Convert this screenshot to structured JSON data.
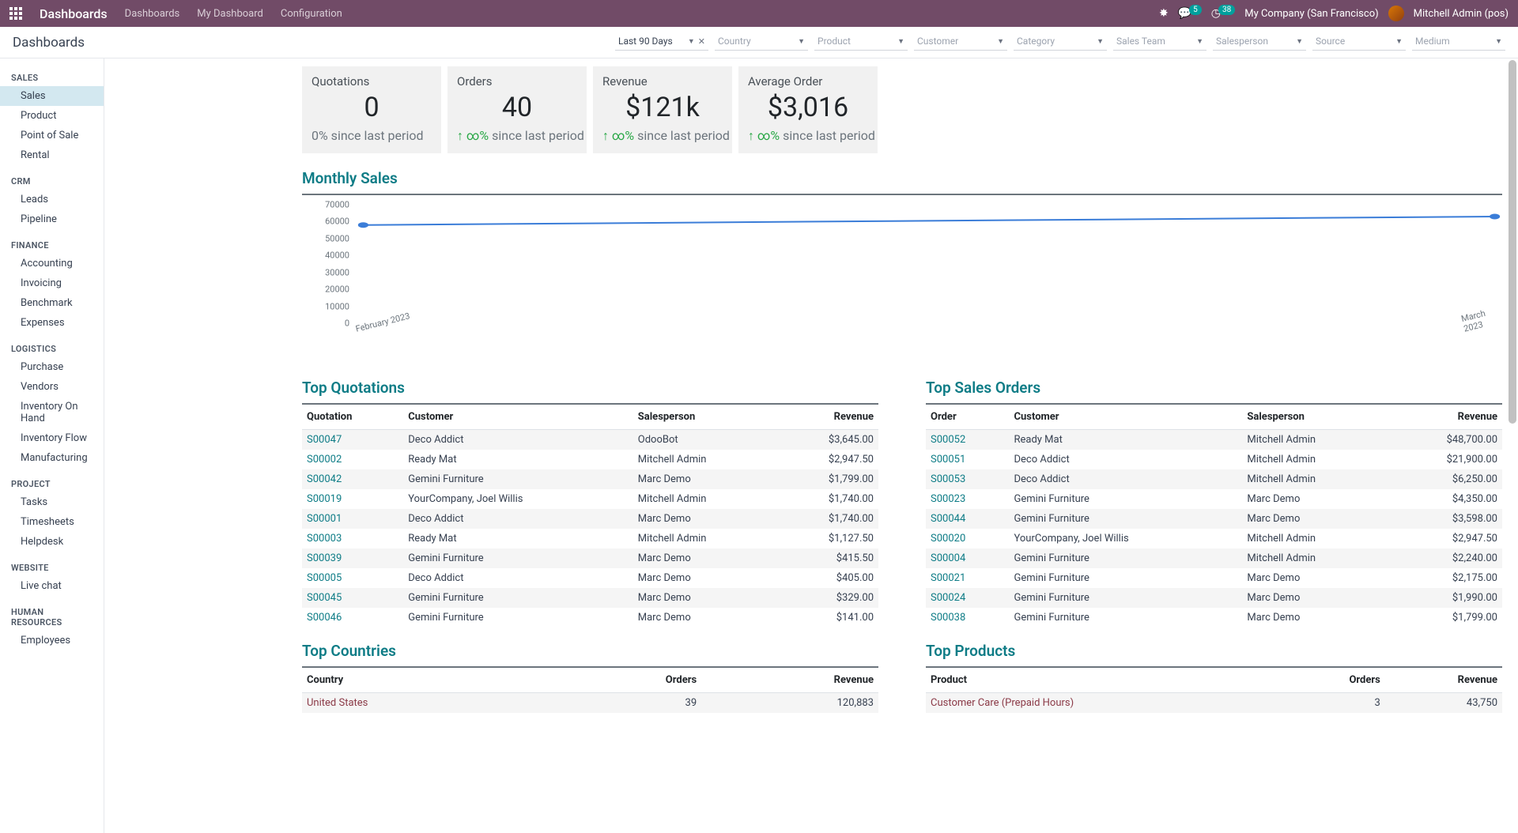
{
  "topnav": {
    "brand": "Dashboards",
    "links": [
      "Dashboards",
      "My Dashboard",
      "Configuration"
    ],
    "msg_badge": "5",
    "clock_badge": "38",
    "company": "My Company (San Francisco)",
    "user": "Mitchell Admin (pos)"
  },
  "page_title": "Dashboards",
  "filters": {
    "period": "Last 90 Days",
    "placeholders": [
      "Country",
      "Product",
      "Customer",
      "Category",
      "Sales Team",
      "Salesperson",
      "Source",
      "Medium"
    ]
  },
  "sidebar": [
    {
      "header": "SALES",
      "items": [
        "Sales",
        "Product",
        "Point of Sale",
        "Rental"
      ],
      "active": "Sales"
    },
    {
      "header": "CRM",
      "items": [
        "Leads",
        "Pipeline"
      ]
    },
    {
      "header": "FINANCE",
      "items": [
        "Accounting",
        "Invoicing",
        "Benchmark",
        "Expenses"
      ]
    },
    {
      "header": "LOGISTICS",
      "items": [
        "Purchase",
        "Vendors",
        "Inventory On Hand",
        "Inventory Flow",
        "Manufacturing"
      ]
    },
    {
      "header": "PROJECT",
      "items": [
        "Tasks",
        "Timesheets",
        "Helpdesk"
      ]
    },
    {
      "header": "WEBSITE",
      "items": [
        "Live chat"
      ]
    },
    {
      "header": "HUMAN RESOURCES",
      "items": [
        "Employees"
      ]
    }
  ],
  "kpis": [
    {
      "label": "Quotations",
      "value": "0",
      "delta": "0% since last period",
      "trend": "none"
    },
    {
      "label": "Orders",
      "value": "40",
      "delta": "∞% since last period",
      "trend": "up"
    },
    {
      "label": "Revenue",
      "value": "$121k",
      "delta": "∞% since last period",
      "trend": "up"
    },
    {
      "label": "Average Order",
      "value": "$3,016",
      "delta": "∞% since last period",
      "trend": "up"
    }
  ],
  "chart_title": "Monthly Sales",
  "chart_data": {
    "type": "line",
    "x": [
      "February 2023",
      "March 2023"
    ],
    "values": [
      58000,
      63000
    ],
    "ylim": [
      0,
      70000
    ],
    "yticks": [
      0,
      10000,
      20000,
      30000,
      40000,
      50000,
      60000,
      70000
    ],
    "xlabel": "",
    "ylabel": ""
  },
  "top_quotations": {
    "title": "Top Quotations",
    "columns": [
      "Quotation",
      "Customer",
      "Salesperson",
      "Revenue"
    ],
    "rows": [
      [
        "S00047",
        "Deco Addict",
        "OdooBot",
        "$3,645.00"
      ],
      [
        "S00002",
        "Ready Mat",
        "Mitchell Admin",
        "$2,947.50"
      ],
      [
        "S00042",
        "Gemini Furniture",
        "Marc Demo",
        "$1,799.00"
      ],
      [
        "S00019",
        "YourCompany, Joel Willis",
        "Mitchell Admin",
        "$1,740.00"
      ],
      [
        "S00001",
        "Deco Addict",
        "Marc Demo",
        "$1,740.00"
      ],
      [
        "S00003",
        "Ready Mat",
        "Mitchell Admin",
        "$1,127.50"
      ],
      [
        "S00039",
        "Gemini Furniture",
        "Marc Demo",
        "$415.50"
      ],
      [
        "S00005",
        "Deco Addict",
        "Marc Demo",
        "$405.00"
      ],
      [
        "S00045",
        "Gemini Furniture",
        "Marc Demo",
        "$329.00"
      ],
      [
        "S00046",
        "Gemini Furniture",
        "Marc Demo",
        "$141.00"
      ]
    ]
  },
  "top_orders": {
    "title": "Top Sales Orders",
    "columns": [
      "Order",
      "Customer",
      "Salesperson",
      "Revenue"
    ],
    "rows": [
      [
        "S00052",
        "Ready Mat",
        "Mitchell Admin",
        "$48,700.00"
      ],
      [
        "S00051",
        "Deco Addict",
        "Mitchell Admin",
        "$21,900.00"
      ],
      [
        "S00053",
        "Deco Addict",
        "Mitchell Admin",
        "$6,250.00"
      ],
      [
        "S00023",
        "Gemini Furniture",
        "Marc Demo",
        "$4,350.00"
      ],
      [
        "S00044",
        "Gemini Furniture",
        "Marc Demo",
        "$3,598.00"
      ],
      [
        "S00020",
        "YourCompany, Joel Willis",
        "Mitchell Admin",
        "$2,947.50"
      ],
      [
        "S00004",
        "Gemini Furniture",
        "Mitchell Admin",
        "$2,240.00"
      ],
      [
        "S00021",
        "Gemini Furniture",
        "Marc Demo",
        "$2,175.00"
      ],
      [
        "S00024",
        "Gemini Furniture",
        "Marc Demo",
        "$1,990.00"
      ],
      [
        "S00038",
        "Gemini Furniture",
        "Marc Demo",
        "$1,799.00"
      ]
    ]
  },
  "top_countries": {
    "title": "Top Countries",
    "columns": [
      "Country",
      "Orders",
      "Revenue"
    ],
    "rows": [
      [
        "United States",
        "39",
        "120,883"
      ]
    ]
  },
  "top_products": {
    "title": "Top Products",
    "columns": [
      "Product",
      "Orders",
      "Revenue"
    ],
    "rows": [
      [
        "Customer Care (Prepaid Hours)",
        "3",
        "43,750"
      ]
    ]
  }
}
